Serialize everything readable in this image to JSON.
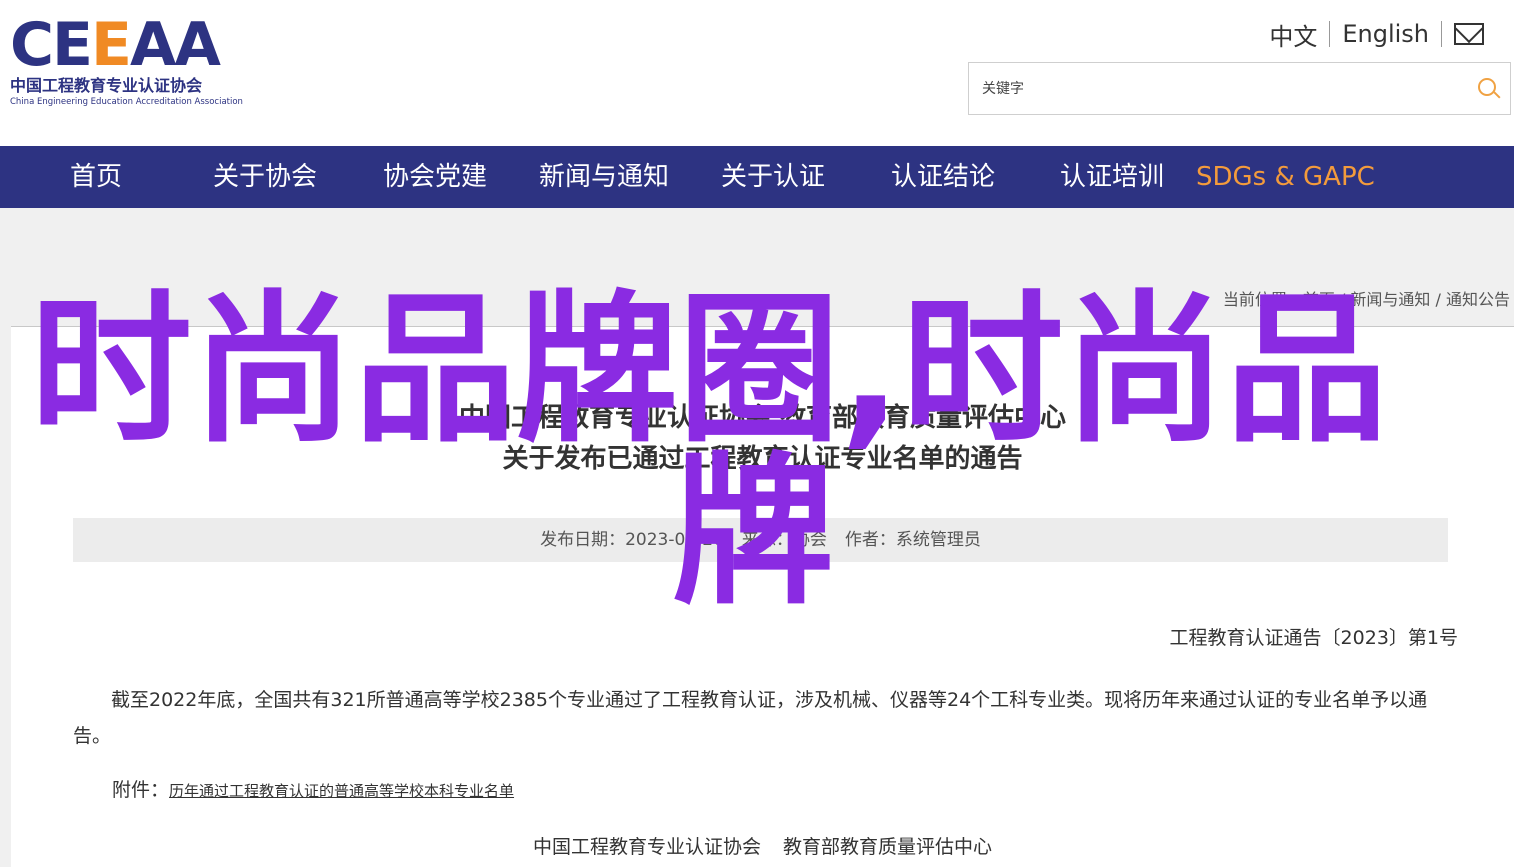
{
  "header": {
    "logo": {
      "mark_a": "CE",
      "mark_b": "E",
      "mark_c": "AA",
      "name_cn": "中国工程教育专业认证协会",
      "name_en": "China Engineering Education Accreditation Association"
    },
    "lang": {
      "chinese": "中文",
      "english": "English"
    },
    "search": {
      "placeholder": "关键字"
    }
  },
  "nav": {
    "items": [
      {
        "label": "首页"
      },
      {
        "label": "关于协会"
      },
      {
        "label": "协会党建"
      },
      {
        "label": "新闻与通知"
      },
      {
        "label": "关于认证"
      },
      {
        "label": "认证结论"
      },
      {
        "label": "认证培训"
      },
      {
        "label": "SDGs & GAPC"
      }
    ],
    "accent_color": "#f39b3c",
    "bar_color": "#2d3382"
  },
  "breadcrumb": {
    "prefix": "当前位置：",
    "items": [
      "首页",
      "新闻与通知",
      "通知公告"
    ],
    "separator": " / "
  },
  "article": {
    "title_line1": "中国工程教育专业认证协会 教育部教育质量评估中心",
    "title_line2": "关于发布已通过工程教育认证专业名单的通告",
    "meta": {
      "date_label": "发布日期：",
      "date_value": "2023-06-20",
      "source_label": "来源：",
      "source_value": "协会",
      "author_label": "作者：",
      "author_value": "系统管理员"
    },
    "doc_number": "工程教育认证通告〔2023〕第1号",
    "body": "截至2022年底，全国共有321所普通高等学校2385个专业通过了工程教育认证，涉及机械、仪器等24个工科专业类。现将历年来通过认证的专业名单予以通告。",
    "attachment_label": "附件：",
    "attachment_link": "历年通过工程教育认证的普通高等学校本科专业名单",
    "signature_1": "中国工程教育专业认证协会",
    "signature_2": "教育部教育质量评估中心"
  },
  "overlay": {
    "line1": "时尚品牌圈,时尚品",
    "line2": "牌",
    "color": "#8a2be2"
  }
}
